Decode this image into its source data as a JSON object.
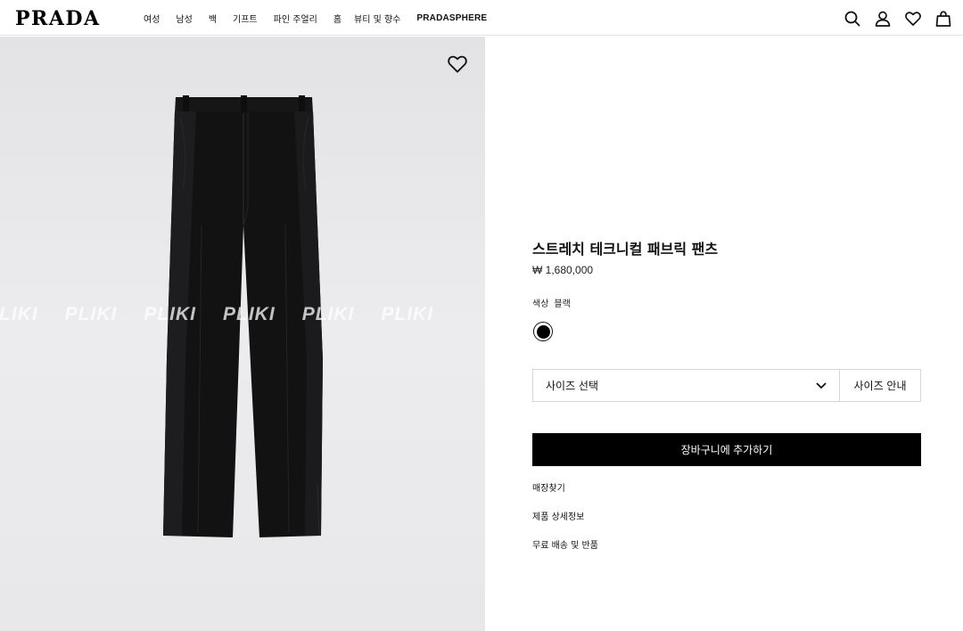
{
  "header": {
    "logo": "PRADA",
    "nav": [
      {
        "label": "여성"
      },
      {
        "label": "남성"
      },
      {
        "label": "백"
      },
      {
        "label": "기프트"
      },
      {
        "label": "파인 주얼리"
      },
      {
        "label": "홈"
      },
      {
        "label": "뷰티 및 향수"
      },
      {
        "label": "PRADASPHERE"
      }
    ],
    "icons": [
      "search-icon",
      "account-icon",
      "wishlist-icon",
      "bag-icon"
    ]
  },
  "image": {
    "watermark": "PLIKI",
    "background": "#e8e8ea"
  },
  "product": {
    "title": "스트레치 테크니컬 패브릭 팬츠",
    "price": "₩ 1,680,000",
    "color_label": "색상",
    "color_value": "블랙",
    "swatch_color": "#000000",
    "size_placeholder": "사이즈 선택",
    "size_guide": "사이즈 안내",
    "add_to_cart": "장바구니에 추가하기",
    "links": [
      "매장찾기",
      "제품 상세정보",
      "무료 배송 및 반품"
    ]
  }
}
